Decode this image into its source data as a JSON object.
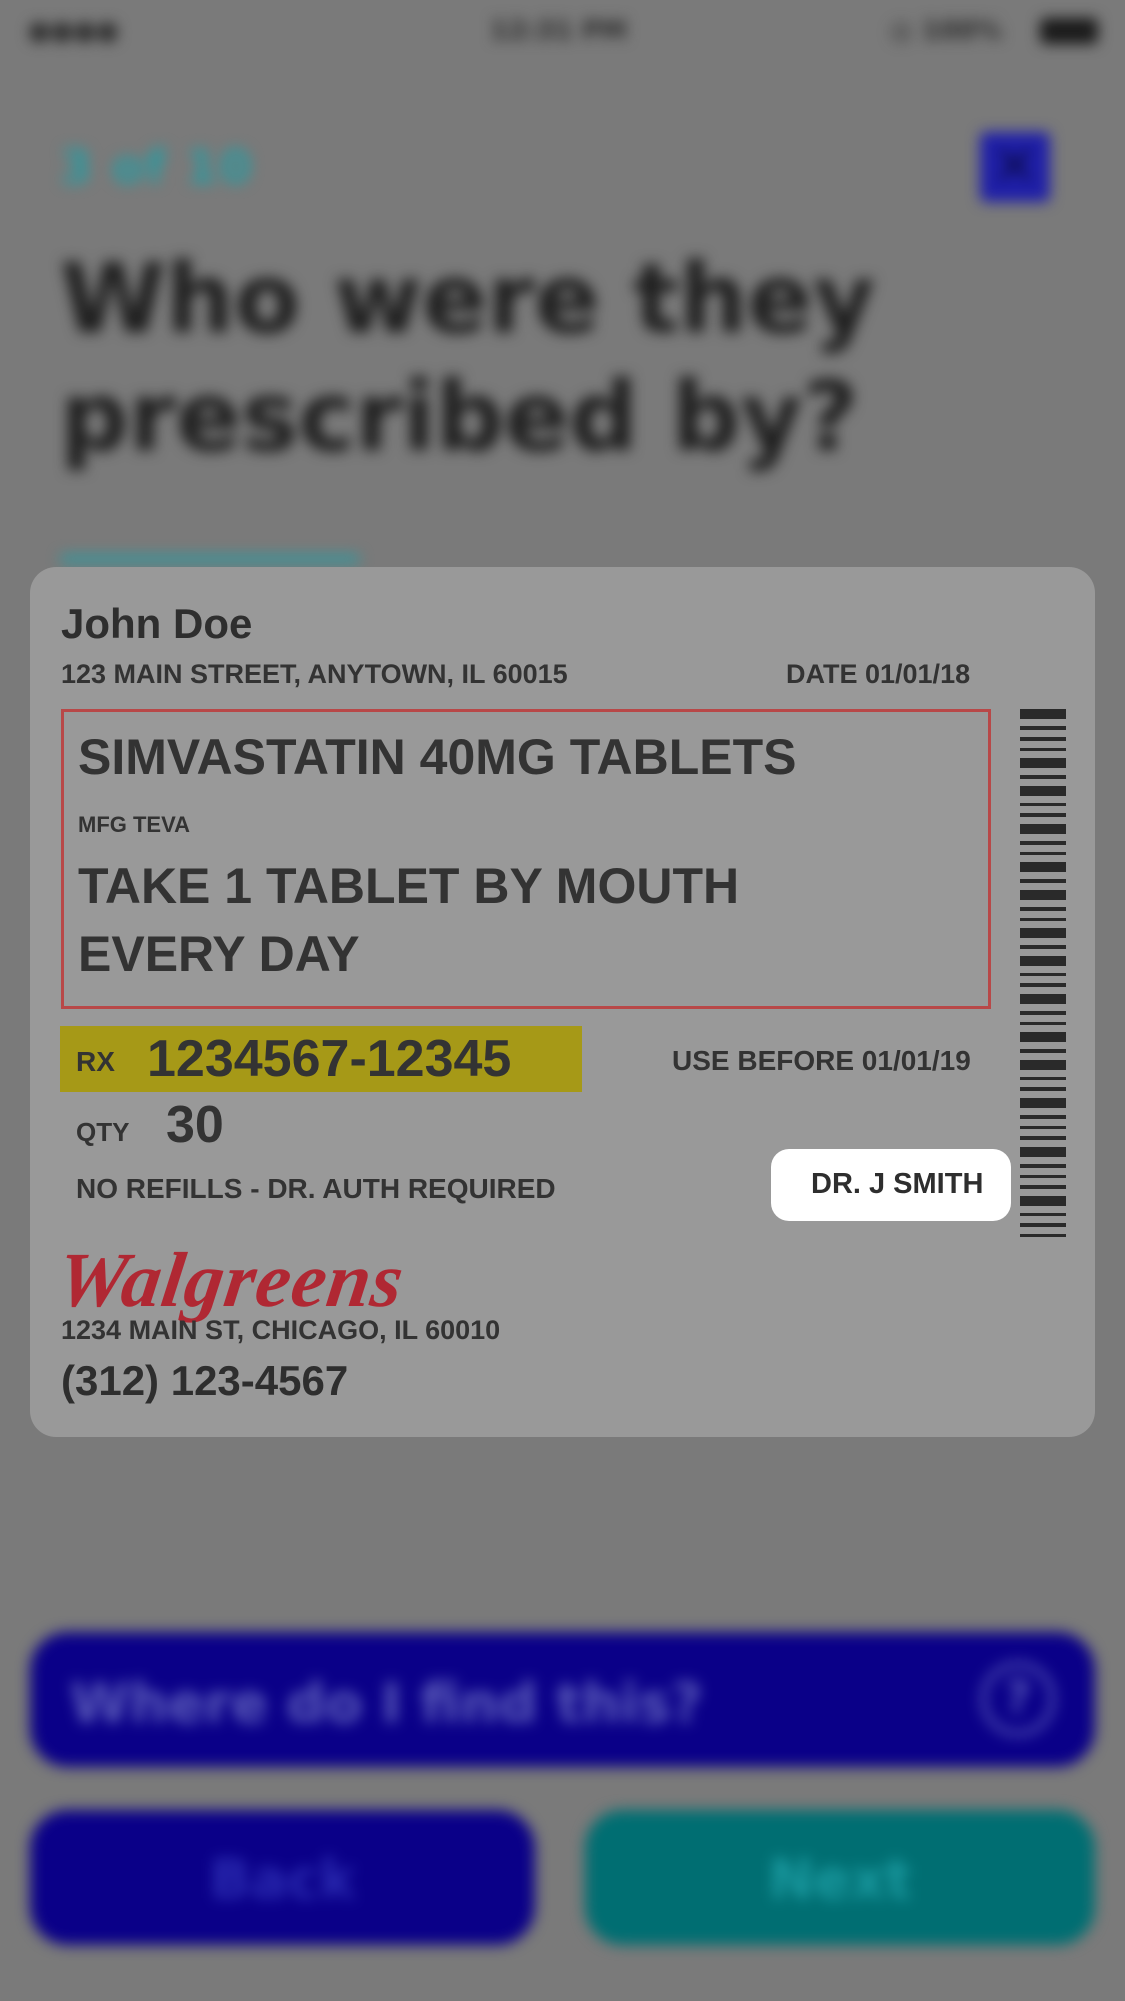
{
  "status_bar": {
    "left": "●●●●",
    "center": "12:31 PM",
    "right": "◎ 100%"
  },
  "header": {
    "step": "3 of 10",
    "question": "Who were they prescribed by?"
  },
  "label": {
    "patient_name": "John Doe",
    "patient_address": "123 MAIN STREET, ANYTOWN, IL 60015",
    "date": "DATE 01/01/18",
    "drug": "SIMVASTATIN 40MG TABLETS",
    "mfg": "MFG TEVA",
    "directions": "TAKE 1 TABLET BY MOUTH EVERY DAY",
    "rx_prefix": "RX",
    "rx_number": "1234567-12345",
    "use_before": "USE BEFORE 01/01/19",
    "qty_label": "QTY",
    "qty_value": "30",
    "refills": "NO REFILLS - DR. AUTH REQUIRED",
    "prescriber": "DR. J SMITH",
    "pharmacy_logo": "Walgreens",
    "pharmacy_address": "1234 MAIN ST, CHICAGO, IL 60010",
    "pharmacy_phone": "(312) 123-4567"
  },
  "footer": {
    "find_label": "Where do I find this?",
    "find_icon": "?",
    "back_label": "Back",
    "next_label": "Next"
  },
  "colors": {
    "highlight": "#a69917",
    "box_border": "#b84848",
    "logo": "#b02833",
    "primary_button": "#0a0088",
    "secondary_button": "#006e72"
  }
}
